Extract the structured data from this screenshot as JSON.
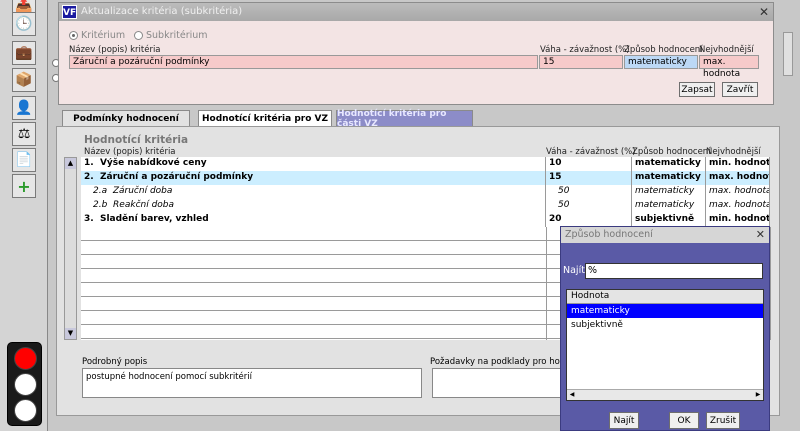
{
  "dialog": {
    "title": "Aktualizace kritéria (subkritéria)",
    "radio_criterion": "Kritérium",
    "radio_subcriterion": "Subkritérium",
    "col_name": "Název (popis) kritéria",
    "col_weight": "Váha - závažnost (%)",
    "col_method": "Způsob hodnocení",
    "col_best": "Nejvhodnější",
    "value_name": "Záruční a pozáruční podmínky",
    "value_weight": "15",
    "value_method": "matematicky",
    "value_best": "max. hodnota",
    "save_label": "Zapsat",
    "close_label": "Zavřít"
  },
  "tabs": [
    {
      "label": "Podmínky hodnocení"
    },
    {
      "label": "Hodnotící kritéria pro VZ"
    },
    {
      "label": "Hodnotící kritéria pro části VZ"
    }
  ],
  "grid": {
    "section_title": "Hodnotící kritéria",
    "col_name": "Název (popis) kritéria",
    "col_weight": "Váha - závažnost (%)",
    "col_method": "Způsob hodnocení",
    "col_best": "Nejvhodnější",
    "rows": [
      {
        "num": "1.",
        "name": "Výše nabídkové ceny",
        "weight": "10",
        "method": "matematicky",
        "best": "min. hodnota"
      },
      {
        "num": "2.",
        "name": "Záruční a pozáruční podmínky",
        "weight": "15",
        "method": "matematicky",
        "best": "max. hodnota"
      },
      {
        "num": "2.a",
        "name": "Záruční doba",
        "weight": "50",
        "method": "matematicky",
        "best": "max. hodnota"
      },
      {
        "num": "2.b",
        "name": "Reakční doba",
        "weight": "50",
        "method": "matematicky",
        "best": "max. hodnota"
      },
      {
        "num": "3.",
        "name": "Sladění barev, vzhled",
        "weight": "20",
        "method": "subjektivně",
        "best": "min. hodnota"
      }
    ]
  },
  "detail": {
    "label": "Podrobný popis",
    "value": "postupné hodnocení pomocí subkritérií",
    "req_label": "Požadavky na podklady pro hodnoc"
  },
  "popup": {
    "title": "Způsob hodnocení",
    "find_label": "Najít",
    "find_value": "%",
    "list_header": "Hodnota",
    "options": [
      "matematicky",
      "subjektivně"
    ],
    "btn_find": "Najít",
    "btn_ok": "OK",
    "btn_cancel": "Zrušit"
  },
  "colors": {
    "selection": "#0000ff",
    "highlight_row": "#cceeff",
    "popup_bg": "#5a5aa6",
    "dialog_bg": "#f3e4e4",
    "red_light": "#ff0000"
  }
}
